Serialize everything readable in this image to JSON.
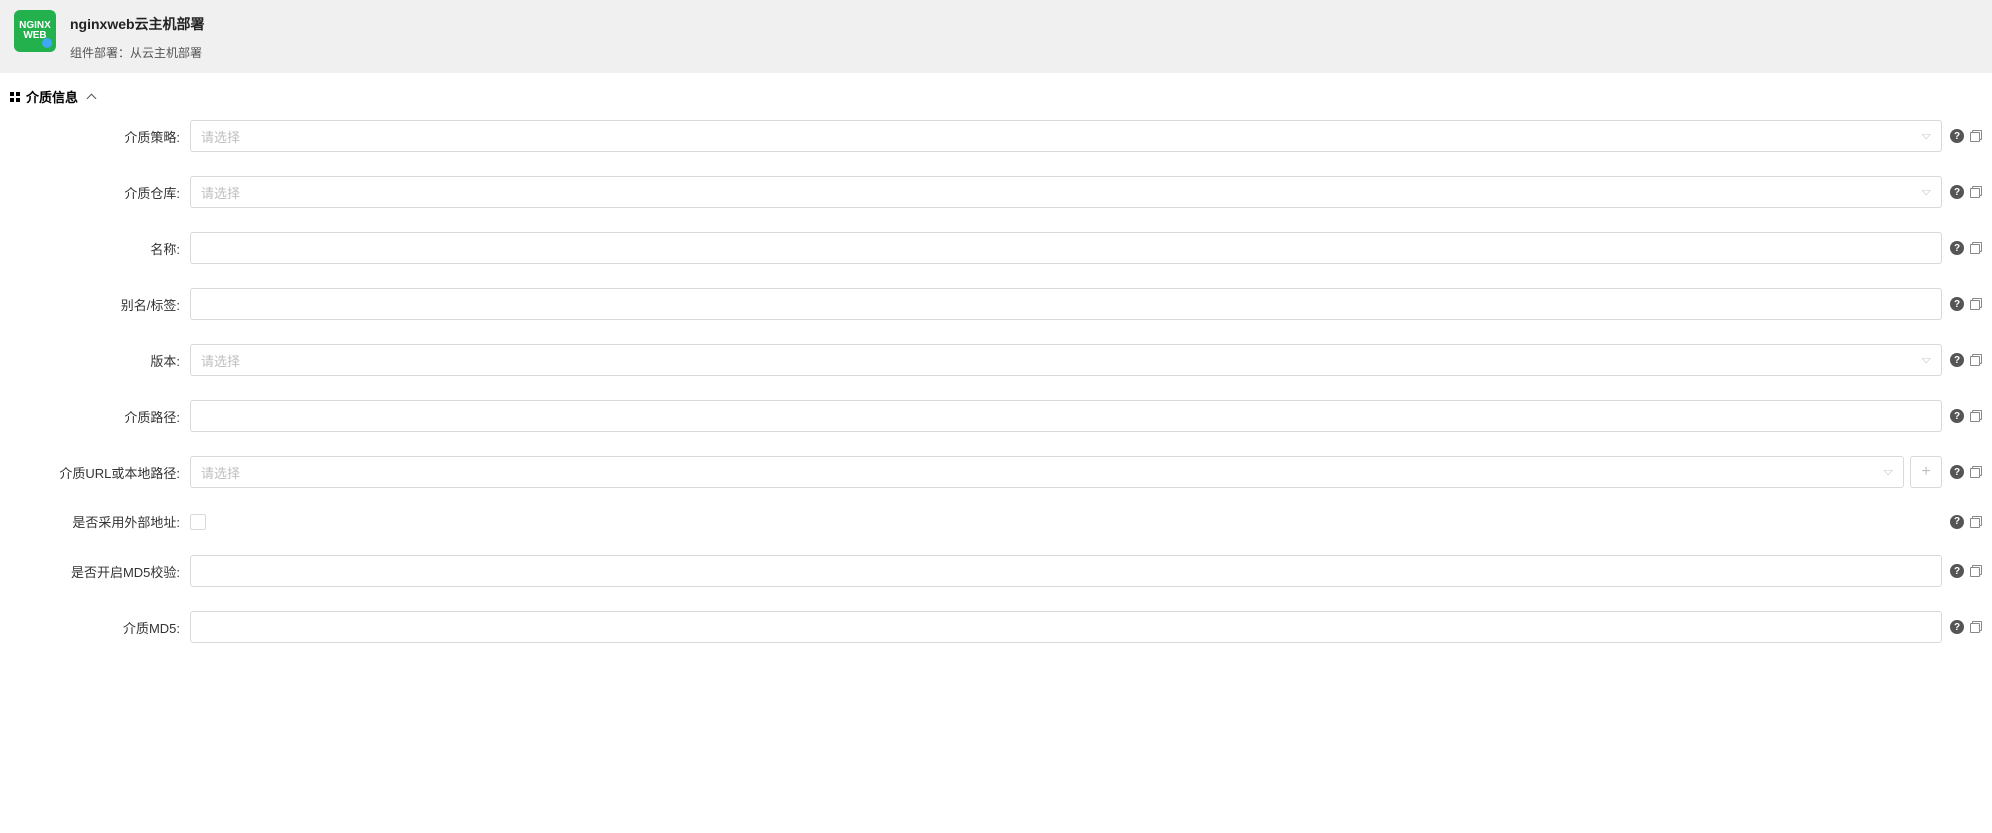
{
  "header": {
    "icon_text_line1": "NGINX",
    "icon_text_line2": "WEB",
    "title": "nginxweb云主机部署",
    "subtitle": "组件部署：从云主机部署"
  },
  "section": {
    "title": "介质信息"
  },
  "fields": {
    "media_strategy": {
      "label": "介质策略:",
      "placeholder": "请选择",
      "type": "select"
    },
    "media_repo": {
      "label": "介质仓库:",
      "placeholder": "请选择",
      "type": "select"
    },
    "name_": {
      "label": "名称:",
      "placeholder": "",
      "type": "text"
    },
    "alias_tag": {
      "label": "别名/标签:",
      "placeholder": "",
      "type": "text"
    },
    "version": {
      "label": "版本:",
      "placeholder": "请选择",
      "type": "select"
    },
    "media_path": {
      "label": "介质路径:",
      "placeholder": "",
      "type": "text"
    },
    "media_url": {
      "label": "介质URL或本地路径:",
      "placeholder": "请选择",
      "type": "select_add"
    },
    "use_external": {
      "label": "是否采用外部地址:",
      "type": "checkbox"
    },
    "enable_md5": {
      "label": "是否开启MD5校验:",
      "placeholder": "",
      "type": "text"
    },
    "media_md5": {
      "label": "介质MD5:",
      "placeholder": "",
      "type": "text"
    }
  }
}
